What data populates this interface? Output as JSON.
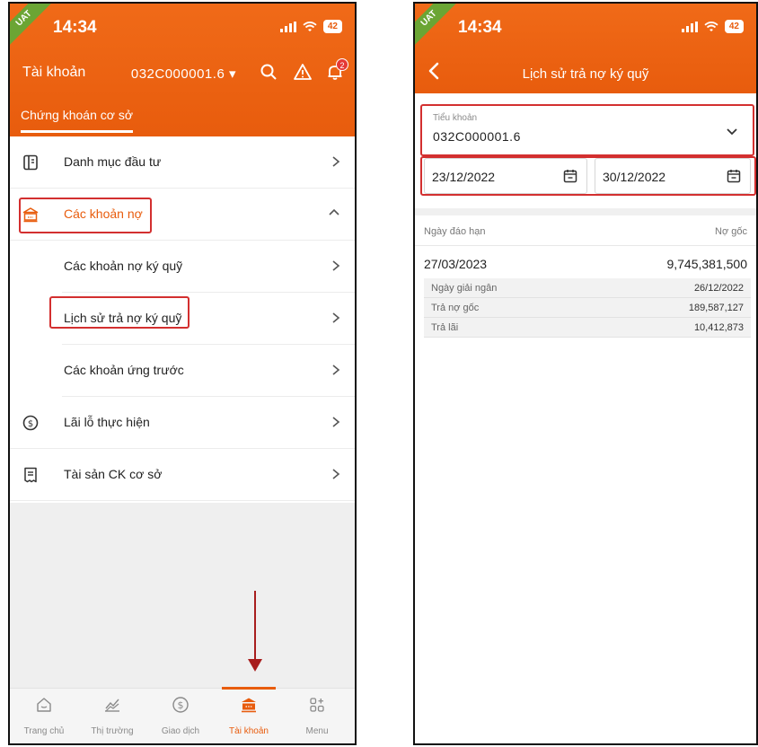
{
  "status_bar": {
    "time": "14:34",
    "env_badge": "UAT",
    "battery": "42"
  },
  "colors": {
    "brand_orange": "#e85c0d",
    "highlight_red": "#d32f2f",
    "arrow_red": "#a81d1d"
  },
  "left_screen": {
    "header": {
      "title": "Tài khoản",
      "account_selector": "032C000001.6",
      "notification_count": "2"
    },
    "subtab": "Chứng khoán cơ sở",
    "menu": [
      {
        "label": "Danh mục đầu tư",
        "icon": "book-icon"
      },
      {
        "label": "Các khoản nợ",
        "icon": "bank-icon"
      },
      {
        "label": "Các khoản nợ ký quỹ"
      },
      {
        "label": "Lịch sử trả nợ ký quỹ"
      },
      {
        "label": "Các khoản ứng trước"
      },
      {
        "label": "Lãi lỗ thực hiện",
        "icon": "dollar-circle-icon"
      },
      {
        "label": "Tài sản CK cơ sở",
        "icon": "receipt-icon"
      }
    ],
    "bottom_nav": [
      {
        "label": "Trang chủ",
        "icon": "home-icon"
      },
      {
        "label": "Thị trường",
        "icon": "chart-icon"
      },
      {
        "label": "Giao dịch",
        "icon": "dollar-circle-icon"
      },
      {
        "label": "Tài khoản",
        "icon": "bank-icon"
      },
      {
        "label": "Menu",
        "icon": "grid-plus-icon"
      }
    ]
  },
  "right_screen": {
    "header": {
      "title": "Lịch sử trả nợ ký quỹ"
    },
    "sub_account": {
      "label": "Tiểu khoản",
      "value": "032C000001.6"
    },
    "date_from": "23/12/2022",
    "date_to": "30/12/2022",
    "table": {
      "col_left": "Ngày đáo hạn",
      "col_right": "Nợ gốc",
      "rows": [
        {
          "due_date": "27/03/2023",
          "principal": "9,745,381,500",
          "details": [
            {
              "label": "Ngày giải ngân",
              "value": "26/12/2022"
            },
            {
              "label": "Trả nợ gốc",
              "value": "189,587,127"
            },
            {
              "label": "Trả lãi",
              "value": "10,412,873"
            }
          ]
        }
      ]
    }
  }
}
